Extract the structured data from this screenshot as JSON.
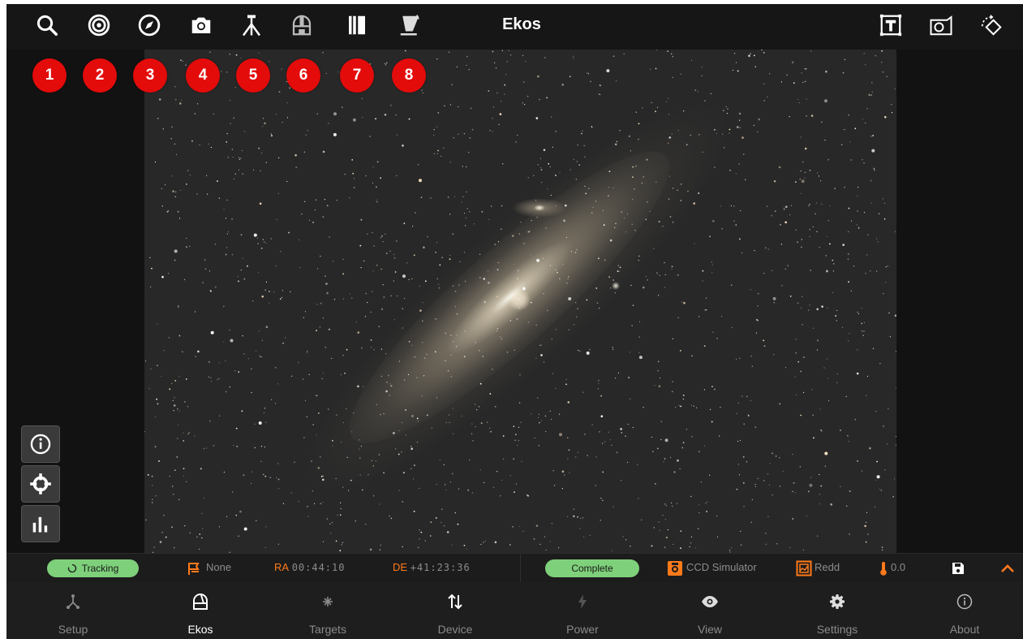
{
  "toolbar": {
    "title": "Ekos",
    "left_icons": [
      "search-icon",
      "target-icon",
      "compass-icon",
      "camera-icon",
      "mount-icon",
      "dome-icon",
      "dust-cap-icon",
      "flat-panel-icon"
    ],
    "right_icons": [
      "text-frame-icon",
      "capture-frame-icon",
      "rotate-icon"
    ]
  },
  "markers": [
    "1",
    "2",
    "3",
    "4",
    "5",
    "6",
    "7",
    "8"
  ],
  "side_tools": [
    "info-icon",
    "crosshair-icon",
    "histogram-icon"
  ],
  "status": {
    "tracking": "Tracking",
    "park_state": "None",
    "ra_label": "RA",
    "ra_value": "00:44:10",
    "de_label": "DE",
    "de_value": "+41:23:36",
    "capture_state": "Complete",
    "camera": "CCD Simulator",
    "filter": "Redd",
    "temperature": "0.0"
  },
  "nav": [
    {
      "label": "Setup",
      "icon": "setup-icon"
    },
    {
      "label": "Ekos",
      "icon": "ekos-icon"
    },
    {
      "label": "Targets",
      "icon": "targets-icon"
    },
    {
      "label": "Device",
      "icon": "device-icon"
    },
    {
      "label": "Power",
      "icon": "power-icon"
    },
    {
      "label": "View",
      "icon": "view-icon"
    },
    {
      "label": "Settings",
      "icon": "settings-icon"
    },
    {
      "label": "About",
      "icon": "about-icon"
    }
  ],
  "colors": {
    "accent": "#ff7a1a",
    "marker": "#e40b0b",
    "pill": "#7ed07a"
  }
}
